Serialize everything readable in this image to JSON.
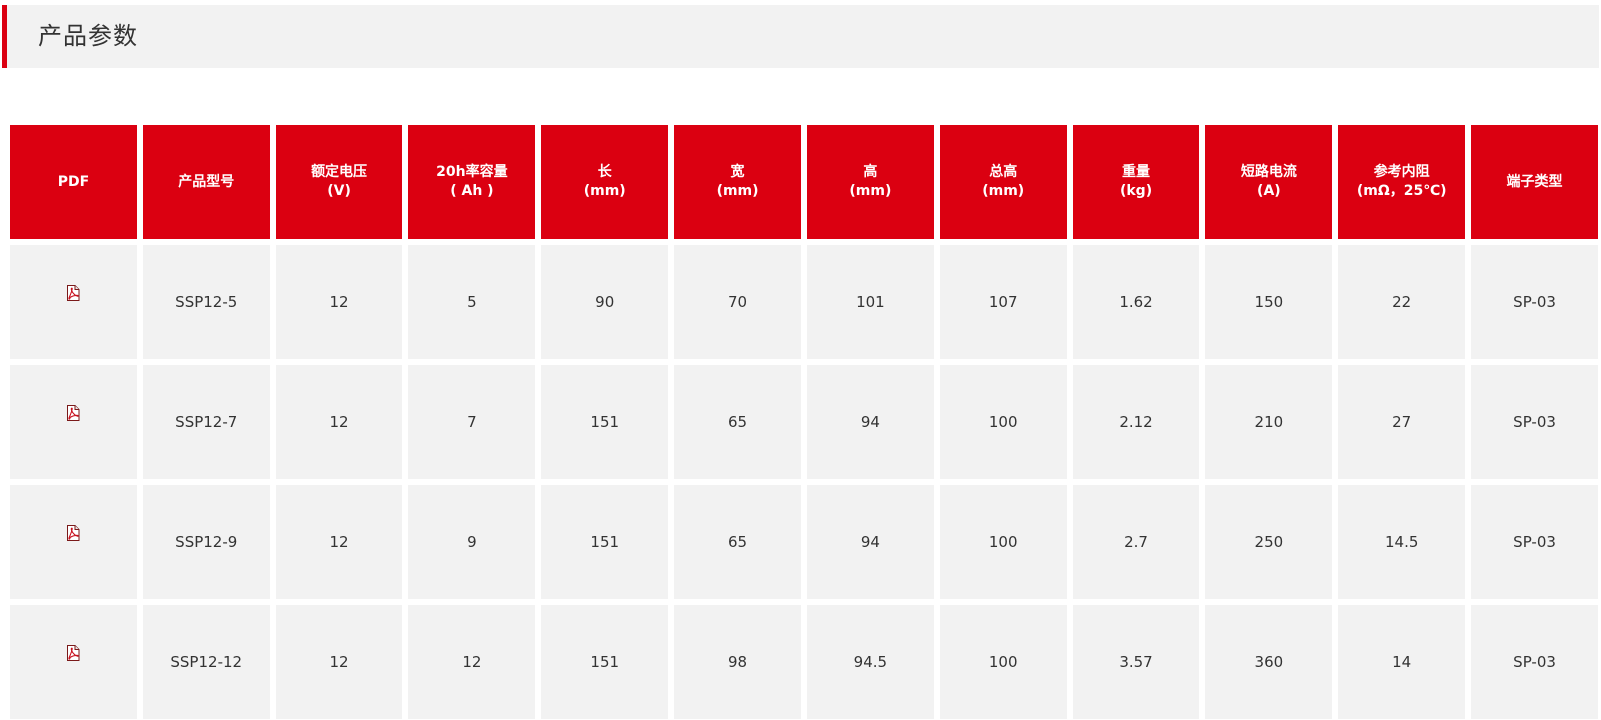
{
  "header": {
    "title": "产品参数"
  },
  "colors": {
    "accent": "#db0011",
    "cell_bg": "#f2f2f2",
    "header_text": "#ffffff",
    "body_text": "#333333"
  },
  "table": {
    "columns": [
      {
        "key": "pdf",
        "lines": [
          "PDF"
        ]
      },
      {
        "key": "model",
        "lines": [
          "产品型号"
        ]
      },
      {
        "key": "voltage",
        "lines": [
          "额定电压",
          "(V)"
        ]
      },
      {
        "key": "capacity",
        "lines": [
          "20h率容量",
          "( Ah )"
        ]
      },
      {
        "key": "length",
        "lines": [
          "长",
          "(mm)"
        ]
      },
      {
        "key": "width",
        "lines": [
          "宽",
          "(mm)"
        ]
      },
      {
        "key": "height",
        "lines": [
          "高",
          "(mm)"
        ]
      },
      {
        "key": "total_height",
        "lines": [
          "总高",
          "(mm)"
        ]
      },
      {
        "key": "weight",
        "lines": [
          "重量",
          "(kg)"
        ]
      },
      {
        "key": "short_current",
        "lines": [
          "短路电流",
          "(A)"
        ]
      },
      {
        "key": "resistance",
        "lines": [
          "参考内阻",
          "(mΩ，25℃)"
        ]
      },
      {
        "key": "terminal",
        "lines": [
          "端子类型"
        ]
      }
    ],
    "rows": [
      {
        "pdf_icon": "pdf-file-icon",
        "model": "SSP12-5",
        "voltage": "12",
        "capacity": "5",
        "length": "90",
        "width": "70",
        "height": "101",
        "total_height": "107",
        "weight": "1.62",
        "short_current": "150",
        "resistance": "22",
        "terminal": "SP-03"
      },
      {
        "pdf_icon": "pdf-file-icon",
        "model": "SSP12-7",
        "voltage": "12",
        "capacity": "7",
        "length": "151",
        "width": "65",
        "height": "94",
        "total_height": "100",
        "weight": "2.12",
        "short_current": "210",
        "resistance": "27",
        "terminal": "SP-03"
      },
      {
        "pdf_icon": "pdf-file-icon",
        "model": "SSP12-9",
        "voltage": "12",
        "capacity": "9",
        "length": "151",
        "width": "65",
        "height": "94",
        "total_height": "100",
        "weight": "2.7",
        "short_current": "250",
        "resistance": "14.5",
        "terminal": "SP-03"
      },
      {
        "pdf_icon": "pdf-file-icon",
        "model": "SSP12-12",
        "voltage": "12",
        "capacity": "12",
        "length": "151",
        "width": "98",
        "height": "94.5",
        "total_height": "100",
        "weight": "3.57",
        "short_current": "360",
        "resistance": "14",
        "terminal": "SP-03"
      }
    ]
  }
}
